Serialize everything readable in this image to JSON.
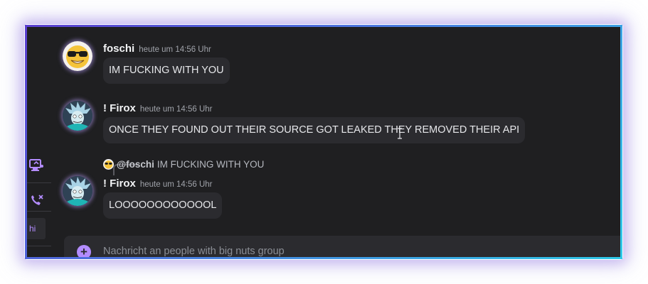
{
  "sidebar": {
    "icons": [
      "screen-share-icon",
      "phone-hangup-icon"
    ],
    "item_label": "hi",
    "accent": "#b38cff"
  },
  "messages": [
    {
      "username": "foschi",
      "timestamp": "heute um 14:56 Uhr",
      "text": "IM FUCKING WITH YOU",
      "avatar": "sunglasses-emoji-avatar"
    },
    {
      "username": "! Firox",
      "timestamp": "heute um 14:56 Uhr",
      "text": "ONCE THEY FOUND OUT THEIR SOURCE GOT LEAKED THEY REMOVED THEIR API",
      "avatar": "rick-avatar"
    },
    {
      "reply": {
        "username": "@foschi",
        "text": "IM FUCKING WITH YOU"
      },
      "username": "! Firox",
      "timestamp": "heute um 14:56 Uhr",
      "text": "LOOOOOOOOOOOOL",
      "avatar": "rick-avatar"
    }
  ],
  "composer": {
    "placeholder": "Nachricht an people with big nuts group",
    "value": ""
  },
  "colors": {
    "background": "#1f1f21",
    "bubble": "#2b2b2f",
    "frame_gradient": [
      "#5b3fd0",
      "#2ec9e8"
    ]
  }
}
